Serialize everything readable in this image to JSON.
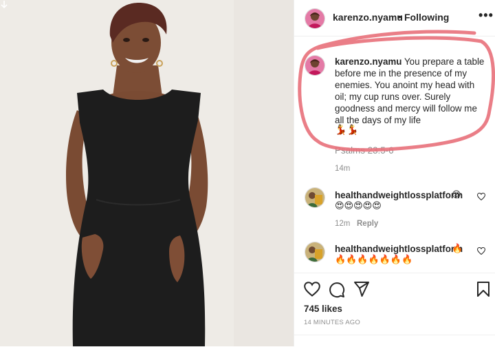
{
  "header": {
    "username": "karenzo.nyamu",
    "separator": "•",
    "follow_status": "Following",
    "more": "•••"
  },
  "caption": {
    "username": "karenzo.nyamu",
    "text": "You prepare a table before me in the presence of my enemies. You anoint my head with oil; my cup runs over. Surely goodness and mercy will follow me all the days of my life",
    "emojis": "💃💃",
    "reference": "Psalms 23:5-6",
    "time": "14m"
  },
  "comments": [
    {
      "username": "healthandweightlossplatform",
      "emoji_inline": "😍",
      "emoji_line": "😍😍😍😍😍",
      "time": "12m",
      "reply": "Reply"
    },
    {
      "username": "healthandweightlossplatform",
      "emoji_inline": "🔥",
      "emoji_line": "🔥🔥🔥🔥🔥🔥🔥"
    }
  ],
  "actions": {
    "likes": "745 likes",
    "timestamp": "14 MINUTES AGO"
  },
  "icons": {
    "download": "arrow-down-icon",
    "like": "heart-icon",
    "comment": "comment-bubble-icon",
    "share": "paper-plane-icon",
    "save": "bookmark-icon"
  },
  "colors": {
    "highlight": "#e8707a",
    "secondary_text": "#8e8e8e",
    "dress": "#1d1d1d",
    "background": "#efece7"
  }
}
